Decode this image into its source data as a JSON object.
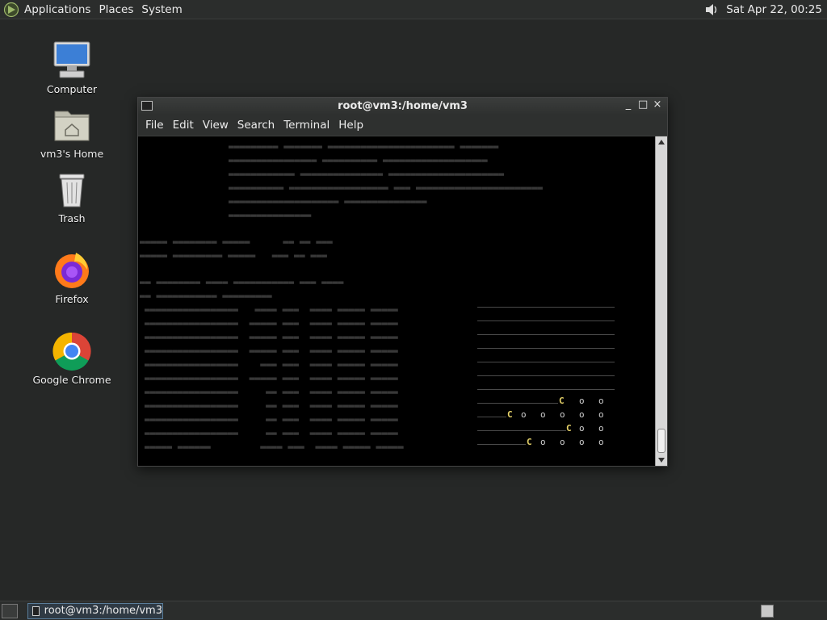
{
  "top_panel": {
    "menu": [
      "Applications",
      "Places",
      "System"
    ],
    "clock": "Sat Apr 22, 00:25",
    "icons": [
      "apps-logo-icon",
      "volume-icon"
    ]
  },
  "desktop": {
    "icons": [
      {
        "name": "computer",
        "label": "Computer",
        "icon": "computer-icon"
      },
      {
        "name": "home",
        "label": "vm3's Home",
        "icon": "home-folder-icon"
      },
      {
        "name": "trash",
        "label": "Trash",
        "icon": "trash-icon"
      },
      {
        "name": "firefox",
        "label": "Firefox",
        "icon": "firefox-icon"
      },
      {
        "name": "chrome",
        "label": "Google Chrome",
        "icon": "chrome-icon"
      }
    ]
  },
  "window": {
    "title": "root@vm3:/home/vm3",
    "menu": [
      "File",
      "Edit",
      "View",
      "Search",
      "Terminal",
      "Help"
    ],
    "controls": {
      "minimize": "_",
      "maximize": "□",
      "close": "×"
    }
  },
  "terminal": {
    "pacman": {
      "c": "C",
      "o": "o"
    }
  },
  "bottom_panel": {
    "task": "root@vm3:/home/vm3"
  }
}
